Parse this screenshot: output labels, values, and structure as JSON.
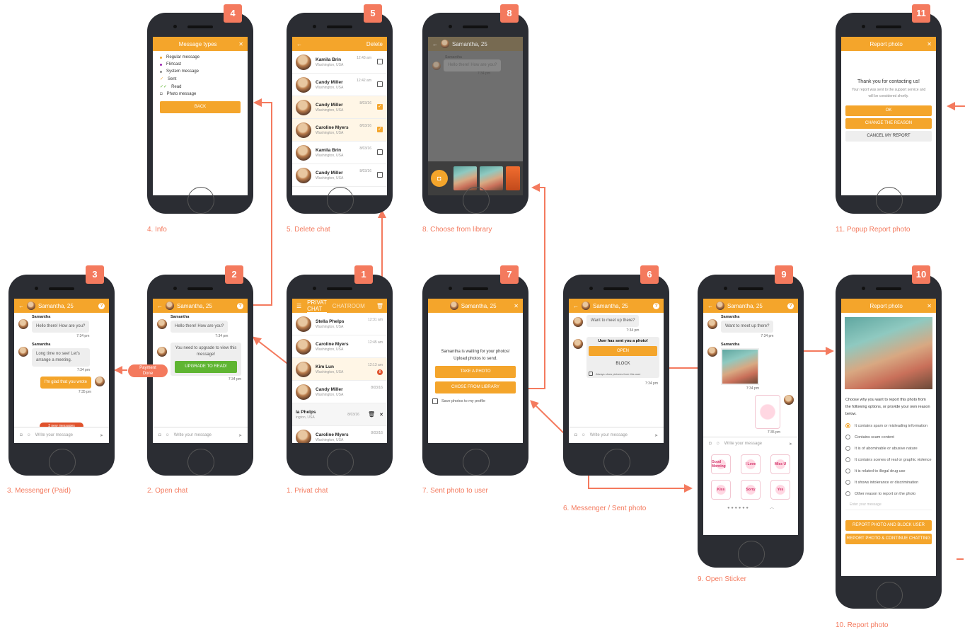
{
  "captions": {
    "s1": "1. Privat chat",
    "s2": "2. Open chat",
    "s3": "3. Messenger (Paid)",
    "s4": "4. Info",
    "s5": "5. Delete chat",
    "s6": "6. Messenger / Sent photo",
    "s7": "7. Sent photo to user",
    "s8": "8. Choose from library",
    "s9": "9. Open Sticker",
    "s10": "10. Report photo",
    "s11": "11. Popup Report photo"
  },
  "badges": {
    "s1": "1",
    "s2": "2",
    "s3": "3",
    "s4": "4",
    "s5": "5",
    "s6": "6",
    "s7": "7",
    "s8": "8",
    "s9": "9",
    "s10": "10",
    "s11": "11"
  },
  "payment_label": "Payment\nDone",
  "common": {
    "chat_title": "Samantha, 25",
    "sender": "Samantha",
    "input_placeholder": "Write your message",
    "hello": "Hello there! How are you?",
    "t734": "7:34 pm",
    "t735": "7:35 pm",
    "meet": "Want to meet up there?"
  },
  "s1": {
    "tab_active": "PRIVAT CHAT",
    "tab_other": "CHATROOM",
    "rows": [
      {
        "name": "Stella Phelps",
        "loc": "Washington, USA",
        "time": "12:31 am"
      },
      {
        "name": "Caroline Myers",
        "loc": "Washington, USA",
        "time": "12:45 am"
      },
      {
        "name": "Kim Lun",
        "loc": "Washington, USA",
        "time": "12:13 am",
        "count": "8"
      },
      {
        "name": "Candy Miller",
        "loc": "Washington, USA",
        "time": "8/03/16"
      },
      {
        "name": "Caroline Myers",
        "loc": "Washington, USA",
        "time": "8/03/16"
      }
    ],
    "swiped": {
      "name": "la Phelps",
      "loc": "ington, USA",
      "time": "8/03/16"
    }
  },
  "s2": {
    "locked": "You need to upgrade to view this message!",
    "upgrade": "UPGRADE TO READ!"
  },
  "s3": {
    "long": "Long time no see! Let's arrange a meeting.",
    "reply": "I'm glad that you wrote",
    "new_msgs": "3 new messages"
  },
  "s4": {
    "title": "Message types",
    "items": [
      "Regular message",
      "Flirtcast",
      "System message",
      "Sent",
      "Read",
      "Photo message"
    ],
    "dot_colors": [
      "#f4a52b",
      "#9c27b0",
      "#888888",
      "#f4a52b",
      "#5fb532",
      "#888888"
    ],
    "back": "BACK"
  },
  "s5": {
    "delete": "Delete",
    "rows": [
      {
        "name": "Kamila Brin",
        "loc": "Washington, USA",
        "time": "12:43 am",
        "checked": false
      },
      {
        "name": "Candy Miller",
        "loc": "Washington, USA",
        "time": "12:42 am",
        "checked": false
      },
      {
        "name": "Candy Miller",
        "loc": "Washington, USA",
        "time": "8/03/16",
        "checked": true
      },
      {
        "name": "Caroline Myers",
        "loc": "Washington, USA",
        "time": "8/03/16",
        "checked": true
      },
      {
        "name": "Kamila Brin",
        "loc": "Washington, USA",
        "time": "8/03/16",
        "checked": false
      },
      {
        "name": "Candy Miller",
        "loc": "Washington, USA",
        "time": "8/03/16",
        "checked": false
      }
    ]
  },
  "s6": {
    "popup_title": "User has sent you a photo!",
    "open": "OPEN",
    "block": "BLOCK",
    "always": "Always show pictures from this user"
  },
  "s7": {
    "waiting": "Samantha is waiting for your photos!",
    "upload": "Upload photos to send.",
    "take": "TAKE A PHOTO",
    "chose": "CHOSE FROM LIBRARY",
    "save": "Save photos to my profile"
  },
  "s8": {
    "header": "Samantha, 25",
    "sender": "Samantha",
    "bubble": "Hello there! How are you?",
    "time": "7:34 pm"
  },
  "s9": {
    "stickers": [
      "Good Morning",
      "I Love",
      "Miss U",
      "Kiss",
      "Sorry",
      "Yes"
    ]
  },
  "s10": {
    "title": "Report photo",
    "intro": "Choose why you want to report this photo from the following options, or provide your own reason below.",
    "options": [
      "It contains spam or misleading information",
      "Contains scam content",
      "It is of abominable or abusive nature",
      "It contains scenes of real or graphic violence",
      "It is related to illegal drug use",
      "It shows intolerance or discrimination",
      "Other reason to report on the photo"
    ],
    "placeholder": "Enter your message",
    "btn1": "REPORT PHOTO AND BLOCK USER",
    "btn2": "REPORT PHOTO & CONTINUE CHATTING"
  },
  "s11": {
    "title": "Report photo",
    "thanks": "Thank you for contacting us!",
    "body": "Your report was sent to the support service and will be considered shortly.",
    "ok": "OK",
    "change": "CHANGE THE REASON",
    "cancel": "CANCEL MY REPORT"
  }
}
